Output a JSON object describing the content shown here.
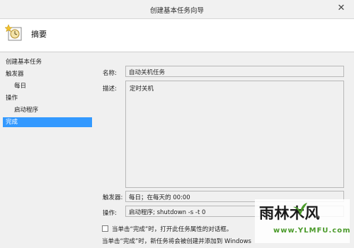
{
  "window": {
    "title": "创建基本任务向导",
    "close_label": "✕"
  },
  "header": {
    "title": "摘要",
    "icon": "clock-task-icon"
  },
  "nav": {
    "items": [
      {
        "label": "创建基本任务",
        "selected": false
      },
      {
        "label": "触发器",
        "selected": false
      },
      {
        "label": "每日",
        "selected": false
      },
      {
        "label": "操作",
        "selected": false
      },
      {
        "label": "启动程序",
        "selected": false
      },
      {
        "label": "完成",
        "selected": true
      }
    ]
  },
  "summary": {
    "name_label": "名称:",
    "name_value": "自动关机任务",
    "desc_label": "描述:",
    "desc_value": "定时关机",
    "trigger_label": "触发器:",
    "trigger_value": "每日；在每天的 00:00",
    "action_label": "操作:",
    "action_value": "启动程序; shutdown -s -t 0"
  },
  "options": {
    "open_properties_label": "当单击“完成”时，打开此任务属性的对话框。",
    "open_properties_checked": false
  },
  "footer_note": "当单击“完成”时，新任务将会被创建并添加到 Windows",
  "watermark": {
    "main": "雨林木风",
    "sub": "www.YLMFU.com"
  },
  "colors": {
    "selection": "#3399ff",
    "watermark_green": "#4a9a2a"
  }
}
